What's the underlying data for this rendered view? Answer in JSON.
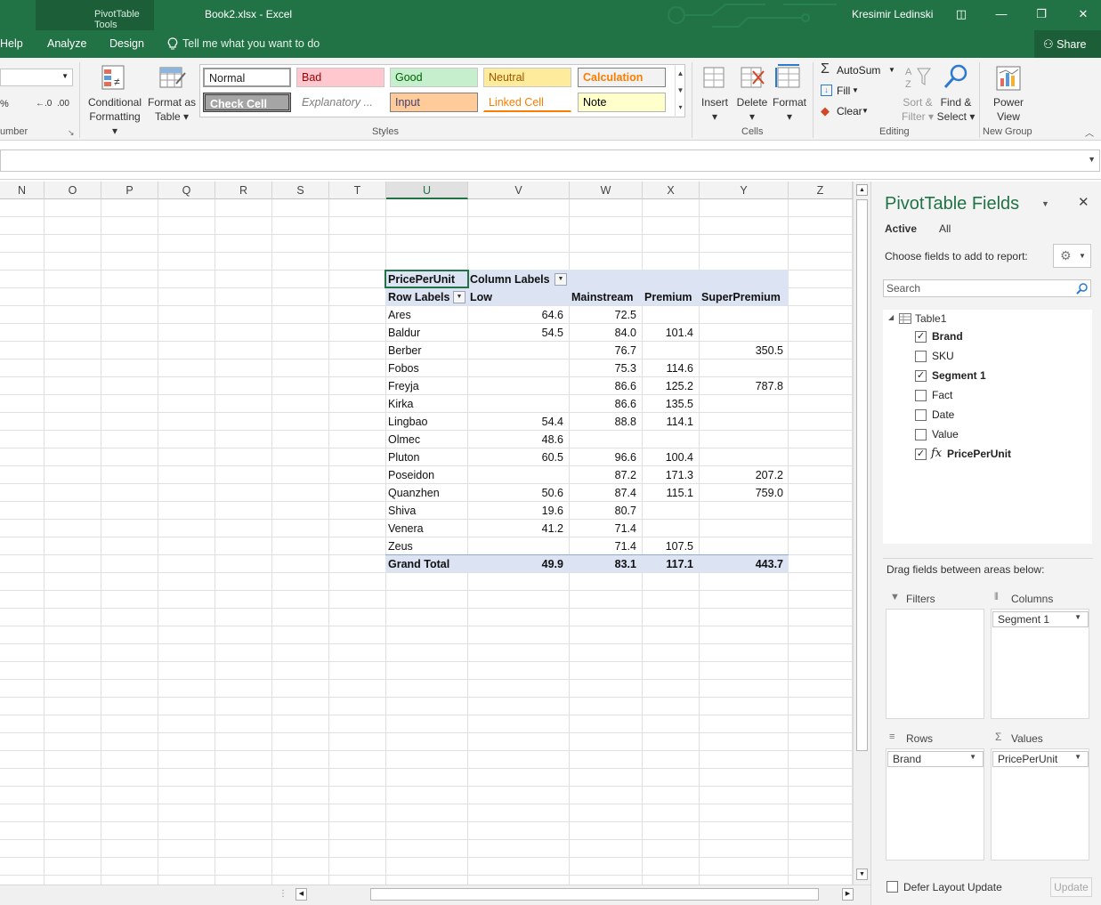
{
  "titlebar": {
    "context_tab": "PivotTable Tools",
    "document_title": "Book2.xlsx  -  Excel",
    "user": "Kresimir Ledinski"
  },
  "tabs": [
    "Help",
    "Analyze",
    "Design"
  ],
  "tell_me": "Tell me what you want to do",
  "share": "Share",
  "ribbon": {
    "number_group_label": "umber",
    "decimal_increase": ".00 →.0",
    "conditional_formatting": [
      "Conditional",
      "Formatting"
    ],
    "format_as_table": [
      "Format as",
      "Table"
    ],
    "styles_label": "Styles",
    "styles": [
      {
        "name": "Normal",
        "bg": "#ffffff",
        "fg": "#000000"
      },
      {
        "name": "Bad",
        "bg": "#ffc7ce",
        "fg": "#9c0006"
      },
      {
        "name": "Good",
        "bg": "#c6efce",
        "fg": "#006100"
      },
      {
        "name": "Neutral",
        "bg": "#ffeb9c",
        "fg": "#9c5700"
      },
      {
        "name": "Calculation",
        "bg": "#f2f2f2",
        "fg": "#fa7d00"
      },
      {
        "name": "Check Cell",
        "bg": "#a5a5a5",
        "fg": "#ffffff"
      },
      {
        "name": "Explanatory ...",
        "bg": "#ffffff",
        "fg": "#7f7f7f"
      },
      {
        "name": "Input",
        "bg": "#ffcc99",
        "fg": "#3f3f76"
      },
      {
        "name": "Linked Cell",
        "bg": "#ffffff",
        "fg": "#fa7d00"
      },
      {
        "name": "Note",
        "bg": "#ffffcc",
        "fg": "#000000"
      }
    ],
    "cells_label": "Cells",
    "insert": "Insert",
    "delete": "Delete",
    "format": "Format",
    "editing_label": "Editing",
    "autosum": "AutoSum",
    "fill": "Fill",
    "clear": "Clear",
    "sort_filter": [
      "Sort &",
      "Filter"
    ],
    "find_select": [
      "Find &",
      "Select"
    ],
    "new_group_label": "New Group",
    "power_view": [
      "Power",
      "View"
    ]
  },
  "columns": [
    "N",
    "O",
    "P",
    "Q",
    "R",
    "S",
    "T",
    "U",
    "V",
    "W",
    "X",
    "Y",
    "Z"
  ],
  "selected_column": "U",
  "pivot": {
    "value_field": "PricePerUnit",
    "column_labels": "Column Labels",
    "row_labels": "Row Labels",
    "headers": [
      "Low",
      "Mainstream",
      "Premium",
      "SuperPremium"
    ],
    "rows": [
      {
        "label": "Ares",
        "values": [
          "64.6",
          "72.5",
          "",
          ""
        ]
      },
      {
        "label": "Baldur",
        "values": [
          "54.5",
          "84.0",
          "101.4",
          ""
        ]
      },
      {
        "label": "Berber",
        "values": [
          "",
          "76.7",
          "",
          "350.5"
        ]
      },
      {
        "label": "Fobos",
        "values": [
          "",
          "75.3",
          "114.6",
          ""
        ]
      },
      {
        "label": "Freyja",
        "values": [
          "",
          "86.6",
          "125.2",
          "787.8"
        ]
      },
      {
        "label": "Kirka",
        "values": [
          "",
          "86.6",
          "135.5",
          ""
        ]
      },
      {
        "label": "Lingbao",
        "values": [
          "54.4",
          "88.8",
          "114.1",
          ""
        ]
      },
      {
        "label": "Olmec",
        "values": [
          "48.6",
          "",
          "",
          ""
        ]
      },
      {
        "label": "Pluton",
        "values": [
          "60.5",
          "96.6",
          "100.4",
          ""
        ]
      },
      {
        "label": "Poseidon",
        "values": [
          "",
          "87.2",
          "171.3",
          "207.2"
        ]
      },
      {
        "label": "Quanzhen",
        "values": [
          "50.6",
          "87.4",
          "115.1",
          "759.0"
        ]
      },
      {
        "label": "Shiva",
        "values": [
          "19.6",
          "80.7",
          "",
          ""
        ]
      },
      {
        "label": "Venera",
        "values": [
          "41.2",
          "71.4",
          "",
          ""
        ]
      },
      {
        "label": "Zeus",
        "values": [
          "",
          "71.4",
          "107.5",
          ""
        ]
      }
    ],
    "grand_total": {
      "label": "Grand Total",
      "values": [
        "49.9",
        "83.1",
        "117.1",
        "443.7"
      ]
    }
  },
  "pane": {
    "title": "PivotTable Fields",
    "tab_active": "Active",
    "tab_all": "All",
    "choose_label": "Choose fields to add to report:",
    "search_placeholder": "Search",
    "table_name": "Table1",
    "fields": [
      {
        "name": "Brand",
        "checked": true
      },
      {
        "name": "SKU",
        "checked": false
      },
      {
        "name": "Segment 1",
        "checked": true
      },
      {
        "name": "Fact",
        "checked": false
      },
      {
        "name": "Date",
        "checked": false
      },
      {
        "name": "Value",
        "checked": false
      },
      {
        "name": "PricePerUnit",
        "checked": true
      }
    ],
    "drag_label": "Drag fields between areas below:",
    "filters_label": "Filters",
    "columns_label": "Columns",
    "rows_label": "Rows",
    "values_label": "Values",
    "columns_item": "Segment 1",
    "rows_item": "Brand",
    "values_item": "PricePerUnit",
    "defer_label": "Defer Layout Update",
    "update_button": "Update"
  }
}
